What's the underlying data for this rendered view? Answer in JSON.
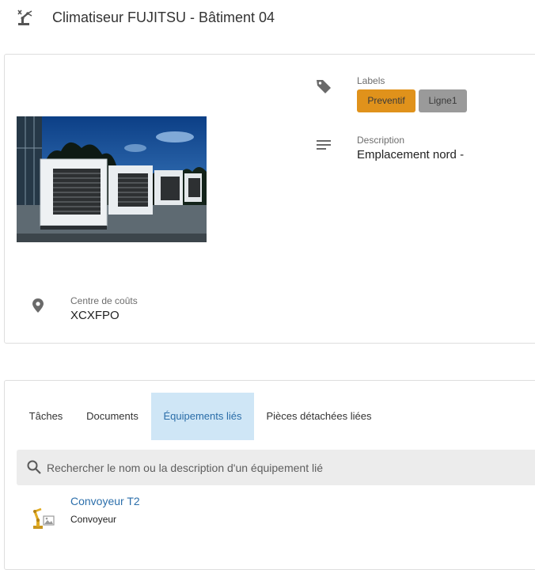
{
  "header": {
    "title": "Climatiseur FUJITSU - Bâtiment 04",
    "icon": "robot-arm-icon"
  },
  "details": {
    "labels": {
      "caption": "Labels",
      "icon": "tag-icon",
      "items": [
        {
          "text": "Preventif",
          "color": "#e0921b"
        },
        {
          "text": "Ligne1",
          "color": "#9a9a9a"
        }
      ]
    },
    "description": {
      "caption": "Description",
      "icon": "description-lines-icon",
      "value": "Emplacement nord -"
    },
    "cost_center": {
      "caption": "Centre de coûts",
      "icon": "location-pin-icon",
      "value": "XCXFPO"
    },
    "image": "outdoor-ac-units-photo"
  },
  "tabs": [
    {
      "label": "Tâches",
      "active": false
    },
    {
      "label": "Documents",
      "active": false
    },
    {
      "label": "Équipements liés",
      "active": true
    },
    {
      "label": "Pièces détachées liées",
      "active": false
    }
  ],
  "search": {
    "placeholder": "Rechercher le nom ou la description d'un équipement lié",
    "value": ""
  },
  "linked_equipment": [
    {
      "name": "Convoyeur T2",
      "type": "Convoyeur",
      "icon": "conveyor-robot-icon"
    }
  ],
  "colors": {
    "accent": "#2c6fab",
    "active_tab_bg": "#cfe6f6",
    "preventif": "#e0921b",
    "ligne": "#9a9a9a"
  }
}
